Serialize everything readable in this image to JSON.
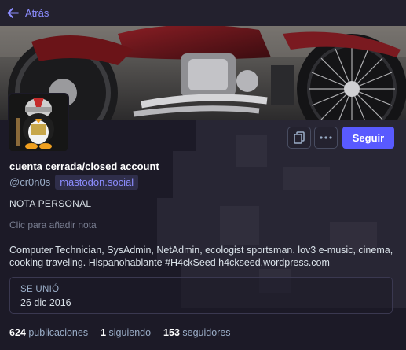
{
  "nav": {
    "back_label": "Atrás"
  },
  "profile": {
    "display_name": "cuenta cerrada/closed account",
    "handle": "@cr0n0s",
    "domain": "mastodon.social",
    "follow_label": "Seguir",
    "note_title": "NOTA PERSONAL",
    "note_hint": "Clic para añadir nota",
    "bio_text": "Computer Technician, SysAdmin, NetAdmin, ecologist sportsman. lov3 e-music, cinema, cooking traveling. Hispanohablante",
    "bio_hashtag": "#H4ckSeed",
    "bio_link": "h4ckseed.wordpress.com",
    "joined_label": "SE UNIÓ",
    "joined_date": "26 dic 2016"
  },
  "stats": {
    "posts_count": "624",
    "posts_label": "publicaciones",
    "following_count": "1",
    "following_label": "siguiendo",
    "followers_count": "153",
    "followers_label": "seguidores"
  },
  "colors": {
    "accent": "#595aff",
    "link": "#8c8dff",
    "background": "#1c1a27"
  },
  "icons": [
    "arrow-left-icon",
    "copy-icon",
    "ellipsis-icon"
  ]
}
